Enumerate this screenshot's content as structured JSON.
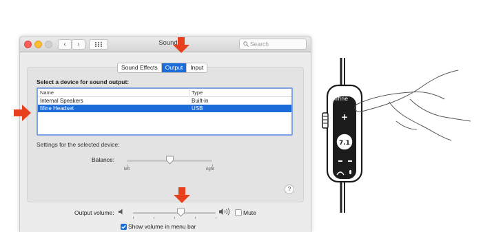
{
  "window": {
    "title": "Sound",
    "search_placeholder": "Search",
    "back_glyph": "‹",
    "forward_glyph": "›"
  },
  "tabs": [
    {
      "label": "Sound Effects",
      "active": false
    },
    {
      "label": "Output",
      "active": true
    },
    {
      "label": "Input",
      "active": false
    }
  ],
  "output": {
    "heading": "Select a device for sound output:",
    "columns": [
      "Name",
      "Type"
    ],
    "devices": [
      {
        "name": "Internal Speakers",
        "type": "Built-in",
        "selected": false
      },
      {
        "name": "fifine Headset",
        "type": "USB",
        "selected": true
      }
    ],
    "settings_label": "Settings for the selected device:",
    "balance_label": "Balance:",
    "balance_left": "left",
    "balance_right": "right",
    "balance_value": 0.5,
    "help_label": "?"
  },
  "volume": {
    "label": "Output volume:",
    "value": 0.55,
    "mute_label": "Mute",
    "mute_checked": false,
    "show_in_menubar_label": "Show volume in menu bar",
    "show_in_menubar_checked": true
  },
  "colors": {
    "selection": "#1b6bd8",
    "arrow": "#e8401e",
    "table_focus": "#7aa3e6"
  },
  "icons": [
    "speaker-low-icon",
    "speaker-high-icon",
    "search-icon",
    "grid-icon",
    "arrow-down-icon",
    "arrow-right-icon",
    "checkmark-icon"
  ],
  "device_photo": {
    "brand": "fifine",
    "center_button": "7.1"
  }
}
